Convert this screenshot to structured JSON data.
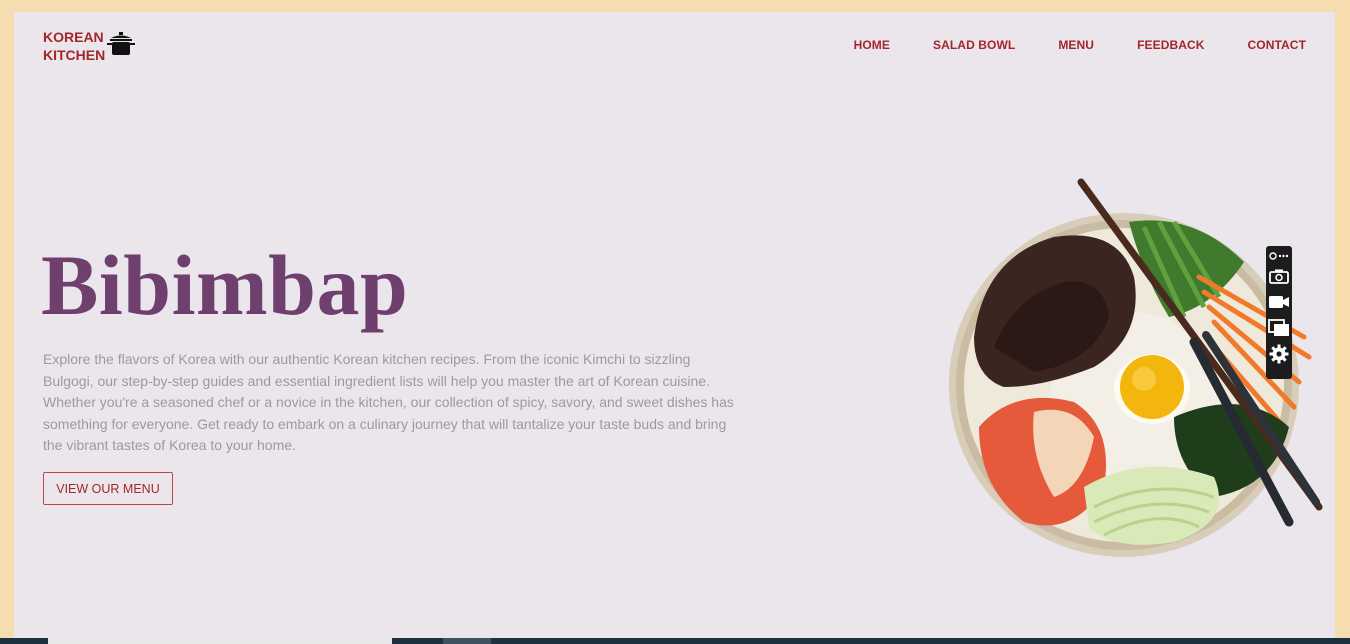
{
  "brand": {
    "line1": "KOREAN",
    "line2": "KITCHEN",
    "icon": "cooking-pot-icon"
  },
  "nav": {
    "items": [
      "HOME",
      "SALAD BOWL",
      "MENU",
      "FEEDBACK",
      "CONTACT"
    ]
  },
  "hero": {
    "title": "Bibimbap",
    "description": "Explore the flavors of Korea with our authentic Korean kitchen recipes. From the iconic Kimchi to sizzling Bulgogi, our step-by-step guides and essential ingredient lists will help you master the art of Korean cuisine. Whether you're a seasoned chef or a novice in the kitchen, our collection of spicy, savory, and sweet dishes has something for everyone. Get ready to embark on a culinary journey that will tantalize your taste buds and bring the vibrant tastes of Korea to your home.",
    "cta_label": "VIEW OUR MENU"
  },
  "floating_toolbar": {
    "icons": [
      "link-more-icon",
      "camera-icon",
      "video-icon",
      "windows-icon",
      "gear-icon"
    ]
  },
  "colors": {
    "accent": "#a3262b",
    "title": "#6f3f6e",
    "page_bg": "#ebe6eb",
    "frame": "#f5ddb0"
  }
}
